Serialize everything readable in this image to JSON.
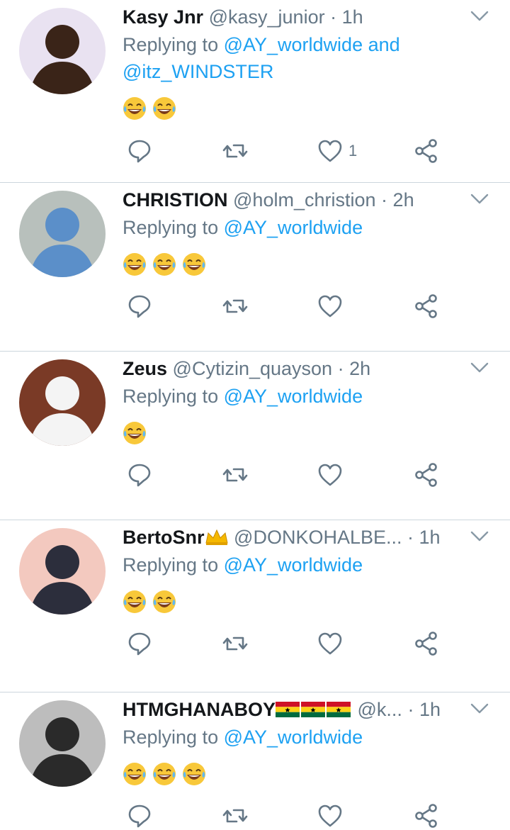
{
  "tweets": [
    {
      "name": "Kasy Jnr",
      "handle": "@kasy_junior",
      "time": "1h",
      "replying_prefix": "Replying to ",
      "mentions_text": "@AY_worldwide and @itz_WINDSTER",
      "emoji_count": 2,
      "like_count": "1",
      "avatar_colors": [
        "#e9e2f1",
        "#3a2418"
      ]
    },
    {
      "name": "CHRISTION",
      "handle": "@holm_christion",
      "time": "2h",
      "replying_prefix": "Replying to ",
      "mentions_text": "@AY_worldwide",
      "emoji_count": 3,
      "like_count": "",
      "avatar_colors": [
        "#b8c0bc",
        "#5b8fc9"
      ]
    },
    {
      "name": "Zeus",
      "handle": "@Cytizin_quayson",
      "time": "2h",
      "replying_prefix": "Replying to ",
      "mentions_text": "@AY_worldwide",
      "emoji_count": 1,
      "like_count": "",
      "avatar_colors": [
        "#7a3a26",
        "#f4f4f4"
      ]
    },
    {
      "name": "BertoSnr",
      "handle": "@DONKOHALBE...",
      "time": "1h",
      "replying_prefix": "Replying to ",
      "mentions_text": "@AY_worldwide",
      "emoji_count": 2,
      "like_count": "",
      "avatar_colors": [
        "#f3c9bf",
        "#2c2e3c"
      ]
    },
    {
      "name": "HTMGHANABOY",
      "handle": "@k...",
      "time": "1h",
      "replying_prefix": "Replying to ",
      "mentions_text": "@AY_worldwide",
      "emoji_count": 3,
      "like_count": "",
      "avatar_colors": [
        "#bdbdbd",
        "#2a2a2a"
      ]
    }
  ],
  "colors": {
    "link": "#1da1f2",
    "muted": "#657786",
    "name": "#14171a",
    "icon": "#657786",
    "divider": "#ccd6dd"
  },
  "icons": [
    "reply-icon",
    "retweet-icon",
    "like-icon",
    "share-icon",
    "chevron-down-icon"
  ]
}
